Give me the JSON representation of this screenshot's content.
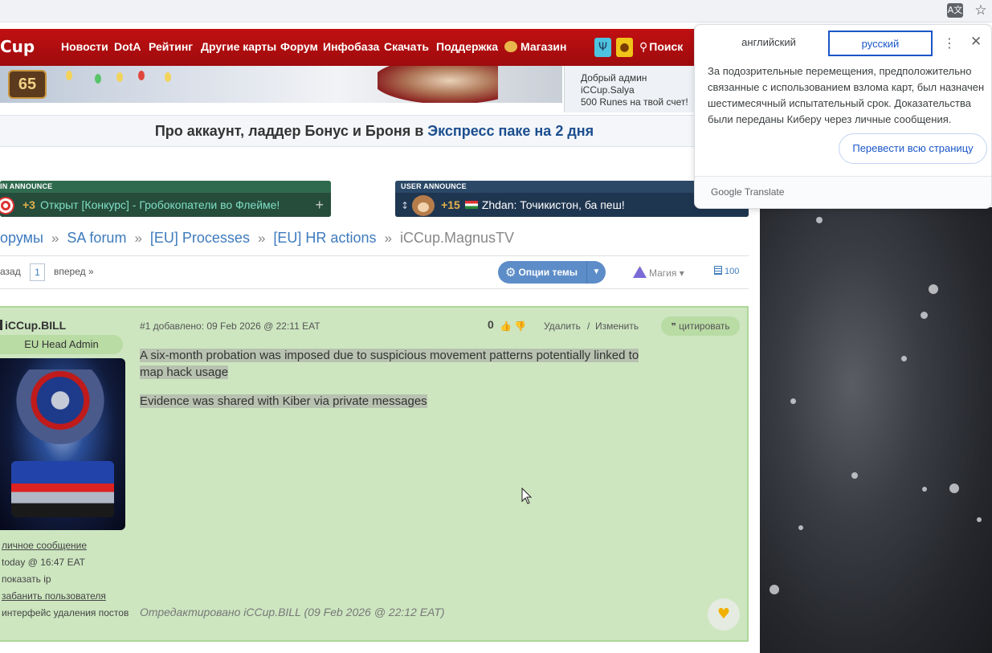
{
  "nav": {
    "logo": "Cup",
    "items": [
      "Новости",
      "DotA",
      "Рейтинг",
      "Другие карты",
      "Форум",
      "Инфобаза",
      "Скачать",
      "Поддержка",
      "Магазин"
    ],
    "search": "Поиск"
  },
  "banner": {
    "level": "65",
    "admin_msg_line1": "Добрый админ iCCup.Salya",
    "admin_msg_line2": "500 Runes на твой счет!"
  },
  "promo": {
    "text": "Про аккаунт, ладдер Бонус и Броня в ",
    "link": "Экспресс паке на 2 дня"
  },
  "announcements": {
    "left": {
      "header": "IN ANNOUNCE",
      "count": "+3",
      "message": "Открыт [Конкурс] - Гробокопатели во Флейме!"
    },
    "right": {
      "header": "USER ANNOUNCE",
      "count": "+15",
      "user": "Zhdan:",
      "message": "Точикистон, ба пеш!"
    }
  },
  "breadcrumbs": {
    "items": [
      "орумы",
      "SA forum",
      "[EU] Processes",
      "[EU] HR actions"
    ],
    "separator": "»",
    "current": "iCCup.MagnusTV"
  },
  "toolbar": {
    "prev": "азад",
    "page": "1",
    "next": "вперед »",
    "options": "Опции темы",
    "magic": "Магия",
    "count": "100"
  },
  "post": {
    "author": "iCCup.BILL",
    "author_title": "EU Head Admin",
    "links": [
      "личное сообщение",
      "today @ 16:47 EAT",
      "показать ip",
      "забанить пользователя",
      "интерфейс удаления постов"
    ],
    "meta": "#1 добавлено: 09 Feb 2026 @ 22:11 EAT",
    "votes": "0",
    "delete": "Удалить",
    "slash": "/",
    "edit": "Изменить",
    "quote": "цитировать",
    "paragraph1_line1": "A six-month probation was imposed due to suspicious movement patterns potentially linked to",
    "paragraph1_line2": "map hack usage",
    "paragraph2": "Evidence was shared with Kiber via private messages",
    "edited": "Отредактировано iCCup.BILL (09 Feb 2026 @ 22:12 EAT)"
  },
  "translate": {
    "lang_from": "английский",
    "lang_to": "русский",
    "text": "За подозрительные перемещения, предположительно связанные с использованием взлома карт, был назначен шестимесячный испытательный срок. Доказательства были переданы Киберу через личные сообщения.",
    "button": "Перевести всю страницу",
    "footer_brand": "Google",
    "footer_product": "Translate"
  },
  "colors": {
    "nav_red": "#c11012",
    "post_green": "#cde6c0",
    "link_blue": "#3e7bbd",
    "accent_blue": "#1a56c8"
  }
}
